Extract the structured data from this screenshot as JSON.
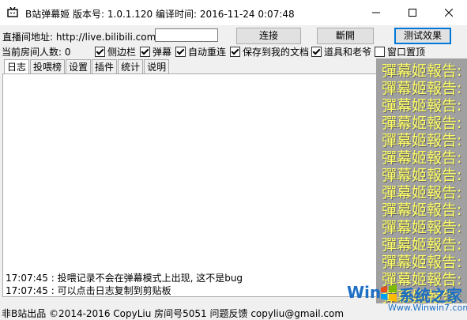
{
  "window": {
    "title": "B站弹幕姬    版本号: 1.0.1.120    编译时间: 2016-11-24 0:07:48"
  },
  "controls": {
    "addr_label": "直播间地址: http://live.bilibili.com/",
    "room_value": "",
    "connect_label": "连接",
    "disconnect_label": "斷開",
    "test_label": "测试效果"
  },
  "viewers": "当前房间人数: 0",
  "options": [
    {
      "label": "侧边栏",
      "checked": true
    },
    {
      "label": "弹幕",
      "checked": true
    },
    {
      "label": "自动重连",
      "checked": true
    },
    {
      "label": "保存到我的文档",
      "checked": true
    },
    {
      "label": "道具和老爷",
      "checked": true
    },
    {
      "label": "窗口置顶",
      "checked": false
    }
  ],
  "tabs": [
    "日志",
    "投喂榜",
    "设置",
    "插件",
    "统计",
    "说明"
  ],
  "log": [
    "17:07:45 : 投喂记录不会在弹幕模式上出现, 这不是bug",
    "17:07:45 : 可以点击日志复制到剪贴板"
  ],
  "overlay_lines": [
    "彈幕姬報告:",
    "彈幕姬報告:",
    "彈幕姬報告:",
    "彈幕姬報告:",
    "彈幕姬報告:",
    "彈幕姬報告:",
    "彈幕姬報告:",
    "彈幕姬報告:",
    "彈幕姬報告:",
    "彈幕姬報告:",
    "彈幕姬報告:",
    "彈幕姬報告:",
    "彈幕姬報告:",
    "彈幕姬報告:"
  ],
  "status": "非B站出品 ©2014-2016 CopyLiu 房间号5051 问题反馈 copyliu@gmail.com",
  "watermark": {
    "brand_left": "Win",
    "brand_right": "系统之家",
    "url": "Www.Winwin7.com"
  },
  "icons": [
    "app-icon",
    "minimize-icon",
    "maximize-icon",
    "close-icon",
    "windows-logo-icon"
  ],
  "colors": {
    "overlay_text": "#ffff66",
    "overlay_bg": "#a0a0a0",
    "focus": "#0078d7"
  }
}
